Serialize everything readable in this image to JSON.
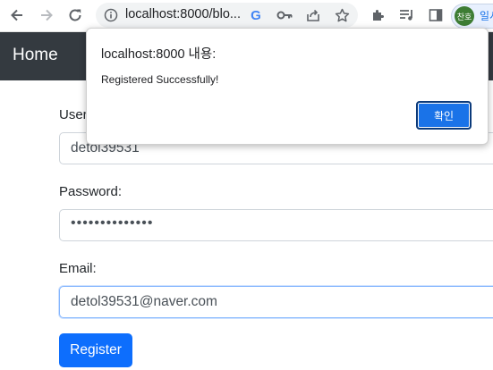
{
  "browser": {
    "url": "localhost:8000/blo...",
    "profile_initials": "찬호",
    "profile_tail": "일시"
  },
  "dialog": {
    "title": "localhost:8000 내용:",
    "message": "Registered Successfully!",
    "ok_label": "확인"
  },
  "navbar": {
    "brand": "Home"
  },
  "form": {
    "username_label": "Username:",
    "username_value": "detol39531",
    "password_label": "Password:",
    "password_value": "••••••••••••••",
    "email_label": "Email:",
    "email_value": "detol39531@naver.com",
    "register_label": "Register"
  },
  "colors": {
    "navbar": "#343a40",
    "primary": "#0d6efd",
    "dialog_button": "#1a73e8"
  }
}
